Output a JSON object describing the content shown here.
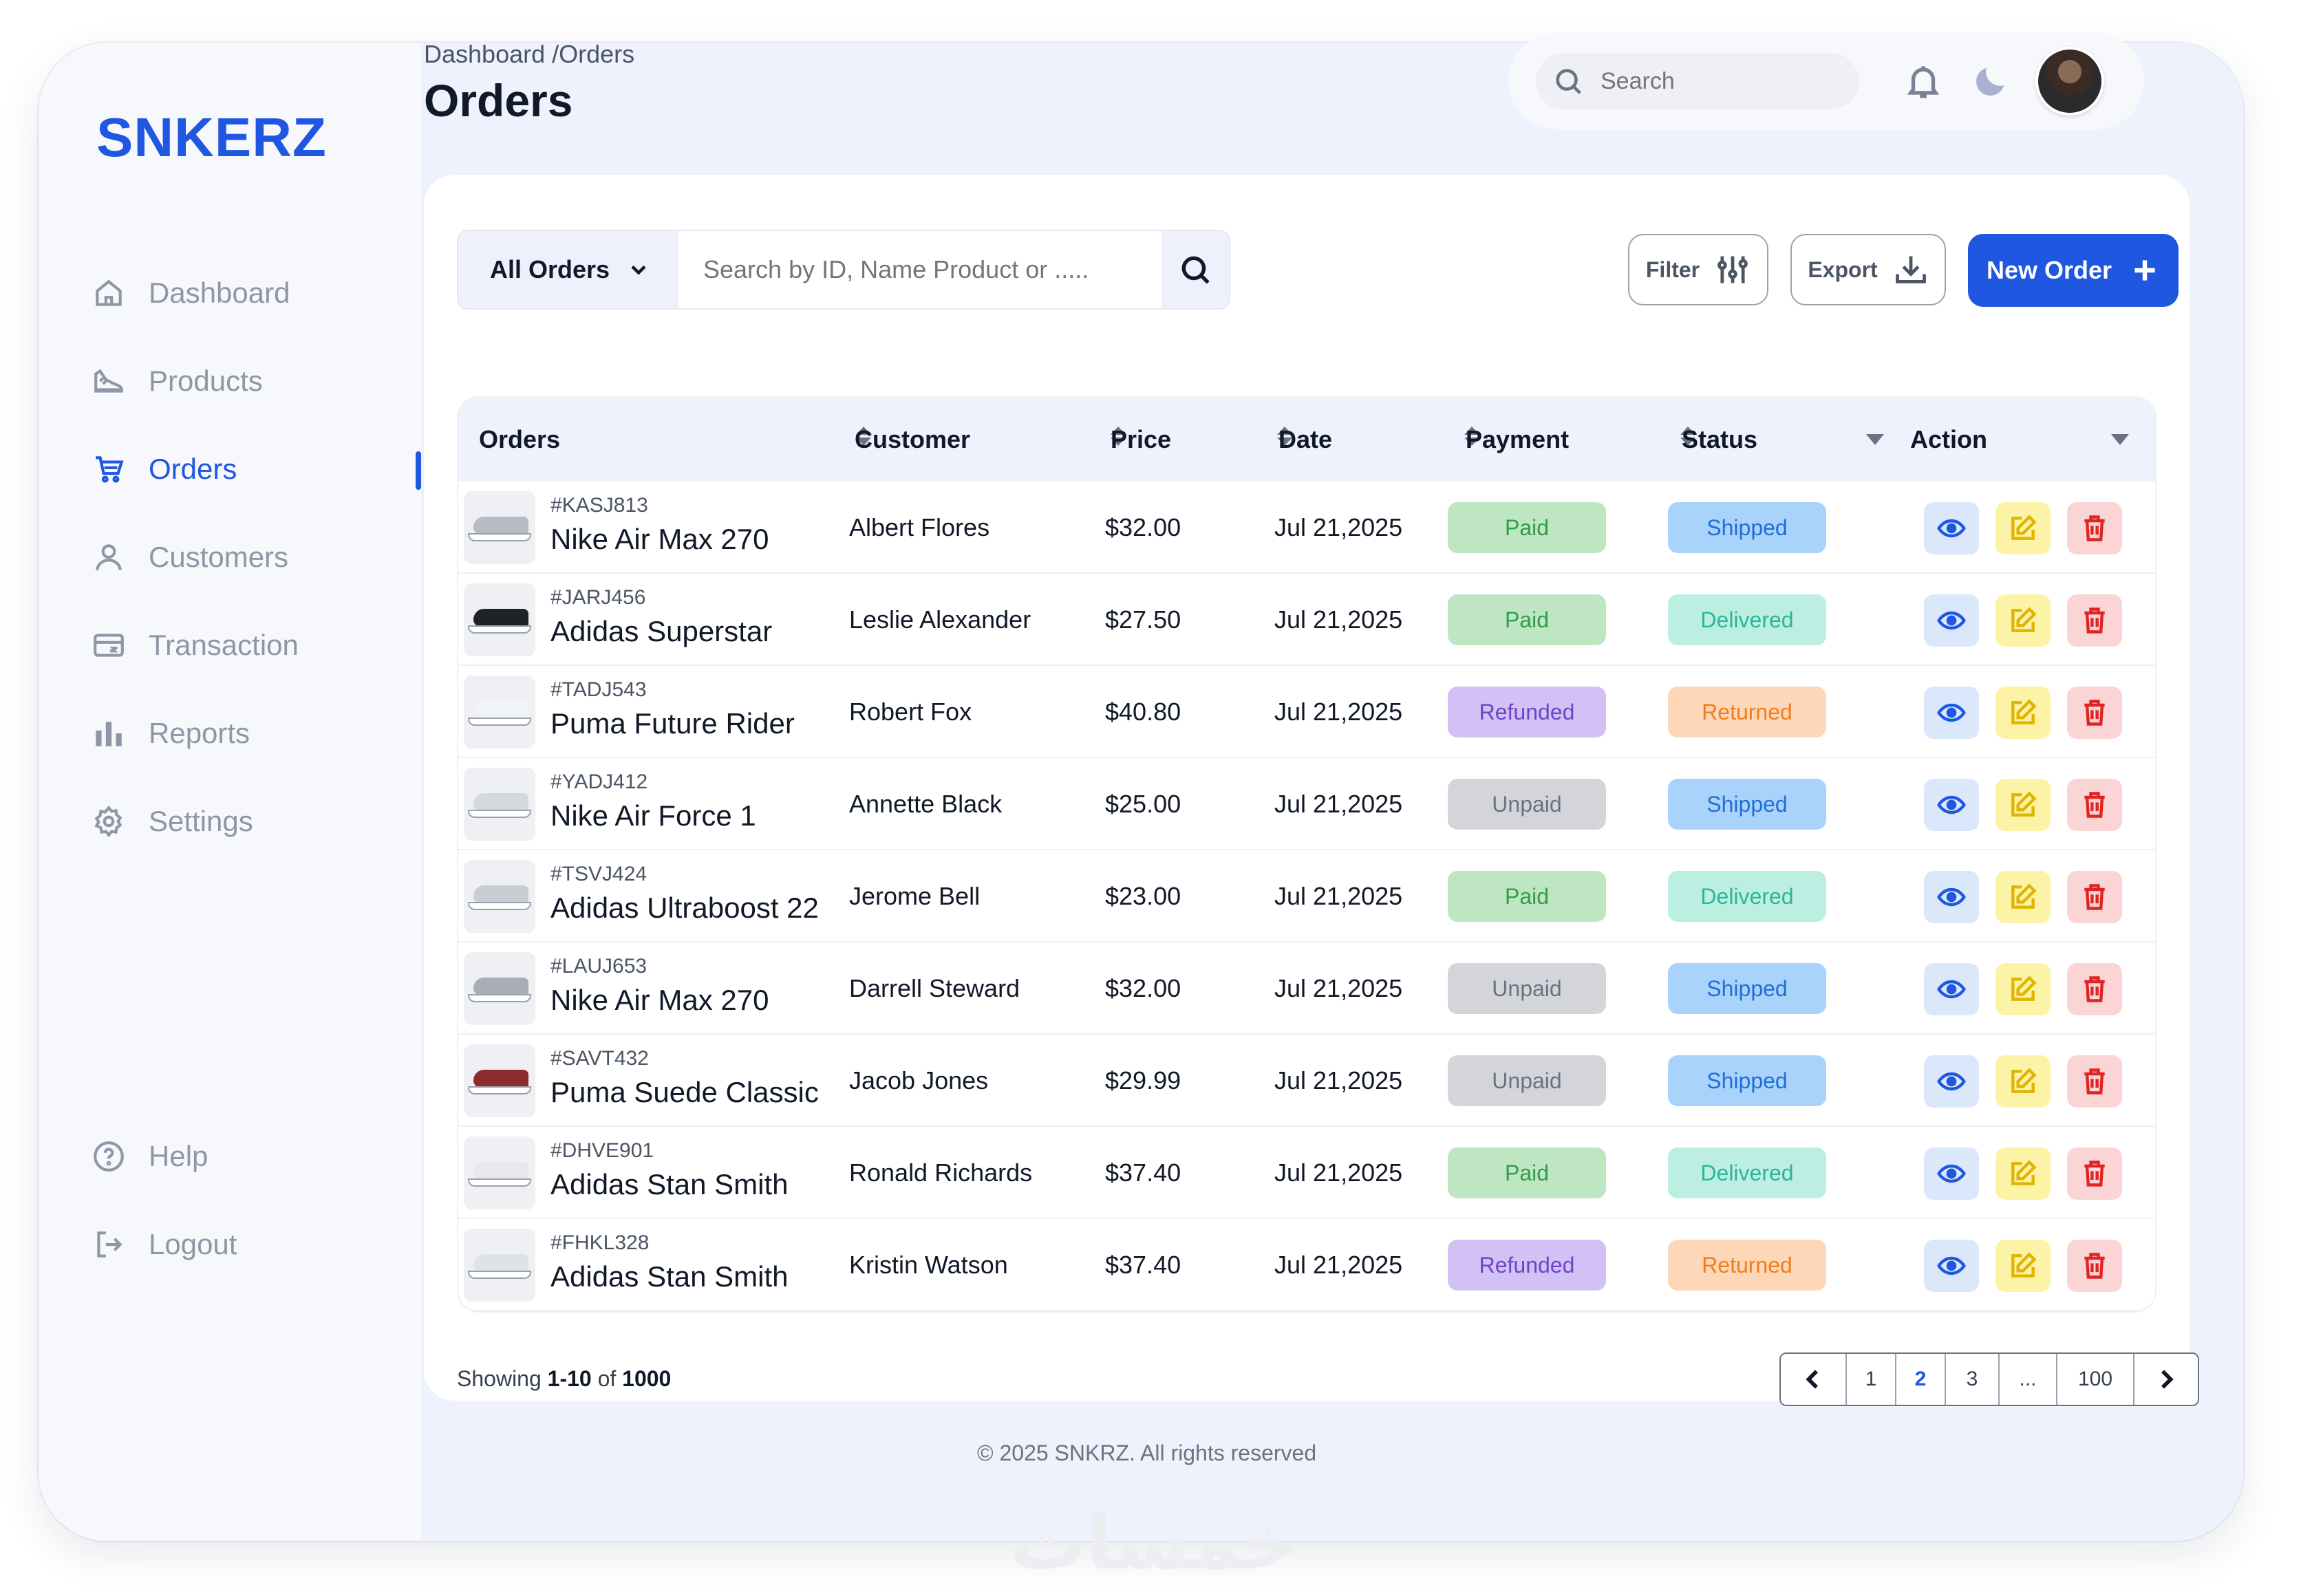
{
  "brand": {
    "logo": "SNKERZ"
  },
  "sidebar": {
    "items": [
      {
        "label": "Dashboard",
        "icon": "home-icon",
        "active": false
      },
      {
        "label": "Products",
        "icon": "shoe-icon",
        "active": false
      },
      {
        "label": "Orders",
        "icon": "cart-icon",
        "active": true
      },
      {
        "label": "Customers",
        "icon": "user-icon",
        "active": false
      },
      {
        "label": "Transaction",
        "icon": "card-icon",
        "active": false
      },
      {
        "label": "Reports",
        "icon": "bar-chart-icon",
        "active": false
      },
      {
        "label": "Settings",
        "icon": "gear-icon",
        "active": false
      }
    ],
    "bottom": [
      {
        "label": "Help",
        "icon": "help-icon"
      },
      {
        "label": "Logout",
        "icon": "logout-icon"
      }
    ]
  },
  "header": {
    "breadcrumb": "Dashboard /Orders",
    "title": "Orders",
    "search_placeholder": "Search"
  },
  "toolbar": {
    "filter_select": "All Orders",
    "search_placeholder": "Search by ID, Name Product or .....",
    "filter_label": "Filter",
    "export_label": "Export",
    "new_order_label": "New Order"
  },
  "table": {
    "columns": [
      "Orders",
      "Customer",
      "Price",
      "Date",
      "Payment",
      "Status",
      "Action"
    ],
    "rows": [
      {
        "id": "#KASJ813",
        "product": "Nike Air Max 270",
        "customer": "Albert Flores",
        "price": "$32.00",
        "date": "Jul 21,2025",
        "payment": "Paid",
        "status": "Shipped",
        "shoe": "#b9bcc4"
      },
      {
        "id": "#JARJ456",
        "product": "Adidas Superstar",
        "customer": "Leslie Alexander",
        "price": "$27.50",
        "date": "Jul 21,2025",
        "payment": "Paid",
        "status": "Delivered",
        "shoe": "#1f2229"
      },
      {
        "id": "#TADJ543",
        "product": "Puma Future Rider",
        "customer": "Robert Fox",
        "price": "$40.80",
        "date": "Jul 21,2025",
        "payment": "Refunded",
        "status": "Returned",
        "shoe": "#f2f3f5"
      },
      {
        "id": "#YADJ412",
        "product": "Nike Air Force 1",
        "customer": "Annette Black",
        "price": "$25.00",
        "date": "Jul 21,2025",
        "payment": "Unpaid",
        "status": "Shipped",
        "shoe": "#d5d8de"
      },
      {
        "id": "#TSVJ424",
        "product": "Adidas Ultraboost 22",
        "customer": "Jerome Bell",
        "price": "$23.00",
        "date": "Jul 21,2025",
        "payment": "Paid",
        "status": "Delivered",
        "shoe": "#c9ccd3"
      },
      {
        "id": "#LAUJ653",
        "product": "Nike Air Max 270",
        "customer": "Darrell Steward",
        "price": "$32.00",
        "date": "Jul 21,2025",
        "payment": "Unpaid",
        "status": "Shipped",
        "shoe": "#a9adb6"
      },
      {
        "id": "#SAVT432",
        "product": "Puma Suede Classic",
        "customer": "Jacob Jones",
        "price": "$29.99",
        "date": "Jul 21,2025",
        "payment": "Unpaid",
        "status": "Shipped",
        "shoe": "#8b2d2d"
      },
      {
        "id": "#DHVE901",
        "product": "Adidas Stan Smith",
        "customer": "Ronald Richards",
        "price": "$37.40",
        "date": "Jul 21,2025",
        "payment": "Paid",
        "status": "Delivered",
        "shoe": "#e6e8ec"
      },
      {
        "id": "#FHKL328",
        "product": "Adidas Stan Smith",
        "customer": "Kristin Watson",
        "price": "$37.40",
        "date": "Jul 21,2025",
        "payment": "Refunded",
        "status": "Returned",
        "shoe": "#dfe2e7"
      }
    ]
  },
  "badge_colors": {
    "Paid": {
      "bg": "#bfe6c3",
      "fg": "#2f9e4a"
    },
    "Refunded": {
      "bg": "#d1c1f5",
      "fg": "#7043c9"
    },
    "Unpaid": {
      "bg": "#d3d5da",
      "fg": "#6b7280"
    },
    "Shipped": {
      "bg": "#a9d3fb",
      "fg": "#1f6fd6"
    },
    "Delivered": {
      "bg": "#bcefe2",
      "fg": "#2bb59a"
    },
    "Returned": {
      "bg": "#fdd7b8",
      "fg": "#f07e1e"
    }
  },
  "pagination": {
    "showing_prefix": "Showing",
    "range": "1-10",
    "of_word": "of",
    "total": "1000",
    "pages": [
      "1",
      "2",
      "3",
      "...",
      "100"
    ],
    "current": "2"
  },
  "footer": {
    "text": "© 2025 SNKRZ. All rights reserved"
  },
  "watermark": "خمسات"
}
